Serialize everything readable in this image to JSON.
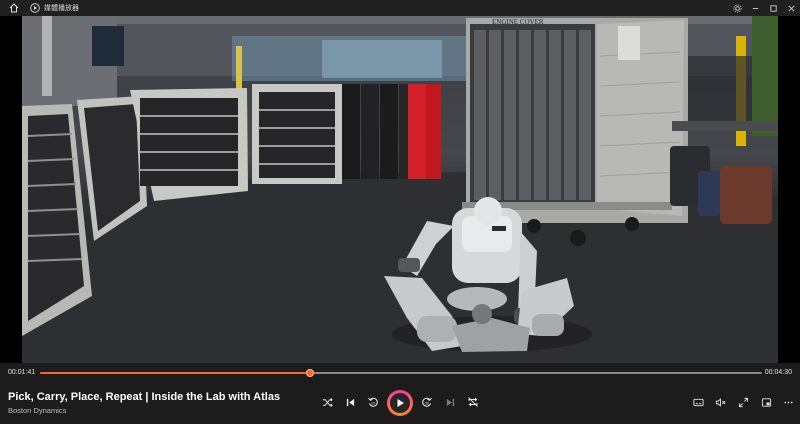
{
  "window": {
    "app_title": "媒體播放器",
    "icons": [
      "home-icon",
      "app-logo-icon",
      "settings-icon",
      "minimize-icon",
      "maximize-icon",
      "close-icon"
    ]
  },
  "video": {
    "scene_label": "ENGINE COVER"
  },
  "player": {
    "current_time": "00:01:41",
    "duration": "00:04:30",
    "progress_fraction": 0.374,
    "accent_color": "#f06a2a",
    "title": "Pick, Carry, Place, Repeat | Inside the Lab with Atlas",
    "channel": "Boston Dynamics",
    "controls": [
      "shuffle-icon",
      "previous-icon",
      "rewind-10-icon",
      "play-icon",
      "forward-30-icon",
      "next-icon",
      "repeat-off-icon",
      "subtitles-icon",
      "volume-mute-icon",
      "fullscreen-icon",
      "mini-player-icon",
      "more-icon"
    ]
  }
}
